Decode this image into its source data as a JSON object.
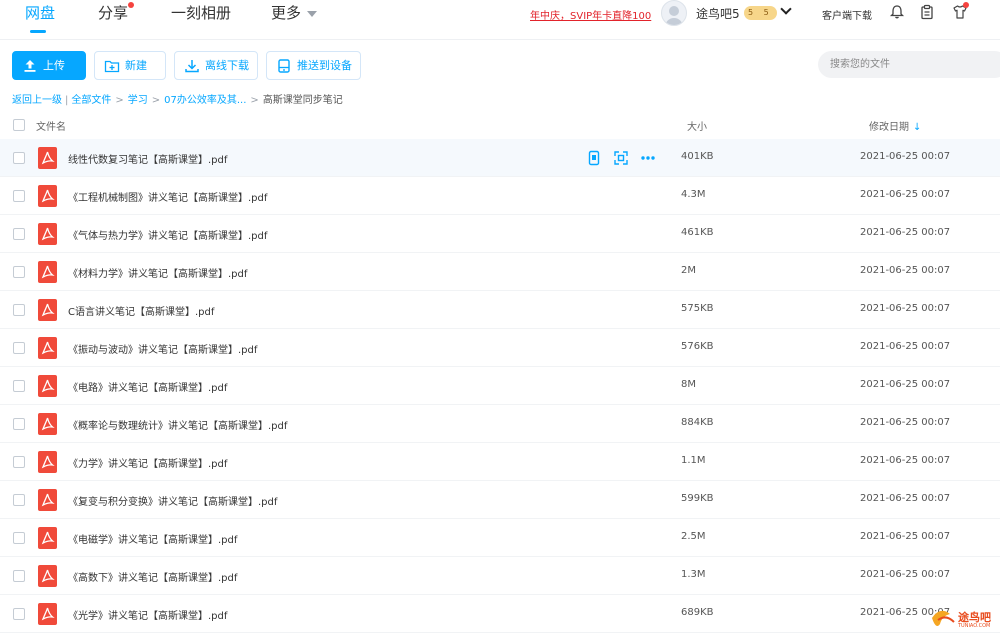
{
  "nav": {
    "tabs": [
      {
        "label": "网盘",
        "active": true
      },
      {
        "label": "分享",
        "has_dot": true
      },
      {
        "label": "一刻相册"
      },
      {
        "label": "更多"
      }
    ],
    "promo": "年中庆，SVIP年卡直降100",
    "username": "途鸟吧5",
    "vip_badge": "5 5",
    "client_download": "客户端下载",
    "icons": [
      "bell-icon",
      "clipboard-icon",
      "shirt-icon"
    ]
  },
  "toolbar": {
    "upload": "上传",
    "new": "新建",
    "offline_download": "离线下载",
    "push_device": "推送到设备",
    "search_placeholder": "搜索您的文件"
  },
  "breadcrumb": {
    "back": "返回上一级",
    "items": [
      "全部文件",
      "学习",
      "07办公效率及其..."
    ],
    "current": "高斯课堂同步笔记"
  },
  "table": {
    "headers": {
      "name": "文件名",
      "size": "大小",
      "date": "修改日期"
    },
    "sort": "date-descending",
    "rows": [
      {
        "name": "线性代数复习笔记【高斯课堂】.pdf",
        "size": "401KB",
        "date": "2021-06-25 00:07"
      },
      {
        "name": "《工程机械制图》讲义笔记【高斯课堂】.pdf",
        "size": "4.3M",
        "date": "2021-06-25 00:07"
      },
      {
        "name": "《气体与热力学》讲义笔记【高斯课堂】.pdf",
        "size": "461KB",
        "date": "2021-06-25 00:07"
      },
      {
        "name": "《材料力学》讲义笔记【高斯课堂】.pdf",
        "size": "2M",
        "date": "2021-06-25 00:07"
      },
      {
        "name": "C语言讲义笔记【高斯课堂】.pdf",
        "size": "575KB",
        "date": "2021-06-25 00:07"
      },
      {
        "name": "《振动与波动》讲义笔记【高斯课堂】.pdf",
        "size": "576KB",
        "date": "2021-06-25 00:07"
      },
      {
        "name": "《电路》讲义笔记【高斯课堂】.pdf",
        "size": "8M",
        "date": "2021-06-25 00:07"
      },
      {
        "name": "《概率论与数理统计》讲义笔记【高斯课堂】.pdf",
        "size": "884KB",
        "date": "2021-06-25 00:07"
      },
      {
        "name": "《力学》讲义笔记【高斯课堂】.pdf",
        "size": "1.1M",
        "date": "2021-06-25 00:07"
      },
      {
        "name": "《复变与积分变换》讲义笔记【高斯课堂】.pdf",
        "size": "599KB",
        "date": "2021-06-25 00:07"
      },
      {
        "name": "《电磁学》讲义笔记【高斯课堂】.pdf",
        "size": "2.5M",
        "date": "2021-06-25 00:07"
      },
      {
        "name": "《高数下》讲义笔记【高斯课堂】.pdf",
        "size": "1.3M",
        "date": "2021-06-25 00:07"
      },
      {
        "name": "《光学》讲义笔记【高斯课堂】.pdf",
        "size": "689KB",
        "date": "2021-06-25 00:07"
      }
    ]
  },
  "watermark": {
    "text": "途鸟吧",
    "sub": "TUNIAO.COM"
  },
  "colors": {
    "accent": "#06a7ff",
    "promo": "#e2232b",
    "pdf": "#f04a3a"
  }
}
